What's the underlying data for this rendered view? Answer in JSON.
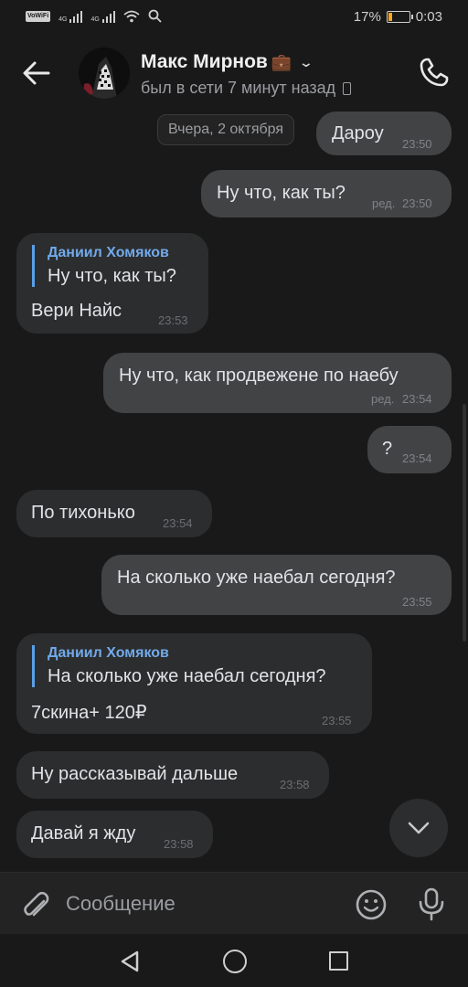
{
  "status_bar": {
    "wifi_badge": "VoWiFi",
    "signal_1_label": "4G",
    "signal_2_label": "4G",
    "battery_percent": "17%",
    "battery_level": 0.17,
    "time": "0:03"
  },
  "header": {
    "name": "Макс Мирнов",
    "name_emoji": "💼",
    "status": "был в сети 7 минут назад",
    "icons": [
      "back-arrow-icon",
      "chevron-down-icon",
      "mobile-device-icon",
      "phone-call-icon"
    ]
  },
  "chat": {
    "date_separator": "Вчера, 2 октября",
    "messages": [
      {
        "direction": "out",
        "text": "Дароу",
        "time": "23:50",
        "edited": ""
      },
      {
        "direction": "out",
        "text": "Ну что, как ты?",
        "time": "23:50",
        "edited": "ред."
      },
      {
        "direction": "in",
        "reply_author": "Даниил Хомяков",
        "reply_text": "Ну что, как ты?",
        "text": "Вери Найс",
        "time": "23:53"
      },
      {
        "direction": "out",
        "text": "Ну что, как продвежене по наебу",
        "time": "23:54",
        "edited": "ред."
      },
      {
        "direction": "out",
        "text": "?",
        "time": "23:54",
        "edited": ""
      },
      {
        "direction": "in",
        "text": "По тихонько",
        "time": "23:54"
      },
      {
        "direction": "out",
        "text": "На сколько уже наебал сегодня?",
        "time": "23:55",
        "edited": ""
      },
      {
        "direction": "in",
        "reply_author": "Даниил Хомяков",
        "reply_text": "На сколько уже наебал сегодня?",
        "text": "7скина+ 120₽",
        "time": "23:55"
      },
      {
        "direction": "in",
        "text": "Ну рассказывай дальше",
        "time": "23:58"
      },
      {
        "direction": "in",
        "text": "Давай я жду",
        "time": "23:58"
      }
    ]
  },
  "composer": {
    "placeholder": "Сообщение",
    "icons": [
      "paperclip-icon",
      "emoji-icon",
      "microphone-icon"
    ]
  },
  "nav_bar": {
    "icons": [
      "nav-back-icon",
      "nav-home-icon",
      "nav-recents-icon"
    ]
  },
  "colors": {
    "background": "#19191a",
    "bubble_out": "#424345",
    "bubble_in": "#2c2d2e",
    "reply_accent": "#71aaeb",
    "battery_fill": "#f5a623"
  }
}
